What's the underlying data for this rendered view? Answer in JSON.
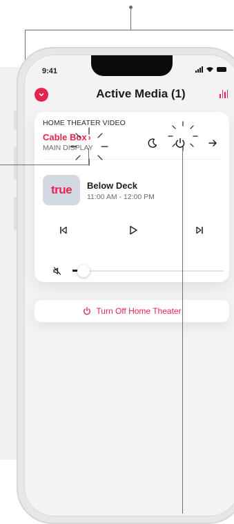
{
  "status_bar": {
    "time": "9:41"
  },
  "header": {
    "title": "Active Media (1)"
  },
  "source": {
    "category": "HOME THEATER VIDEO",
    "name": "Cable Box",
    "name_chevron": "›",
    "display": "MAIN DISPLAY"
  },
  "now_playing": {
    "logo_text": "true",
    "title": "Below Deck",
    "time": "11:00 AM - 12:00 PM"
  },
  "volume": {
    "muted": true,
    "level": 0.04
  },
  "turn_off_button": {
    "label": "Turn Off Home Theater"
  },
  "colors": {
    "accent": "#E6234E",
    "screen_bg": "#F3F3F5",
    "card_bg": "#FFFFFF",
    "logo_tile": "#D3D9E2"
  },
  "icons": [
    "chevron-down-icon",
    "equalizer-icon",
    "moon-icon",
    "power-icon",
    "arrow-right-icon",
    "skip-previous-icon",
    "play-icon",
    "skip-next-icon",
    "mute-icon"
  ]
}
